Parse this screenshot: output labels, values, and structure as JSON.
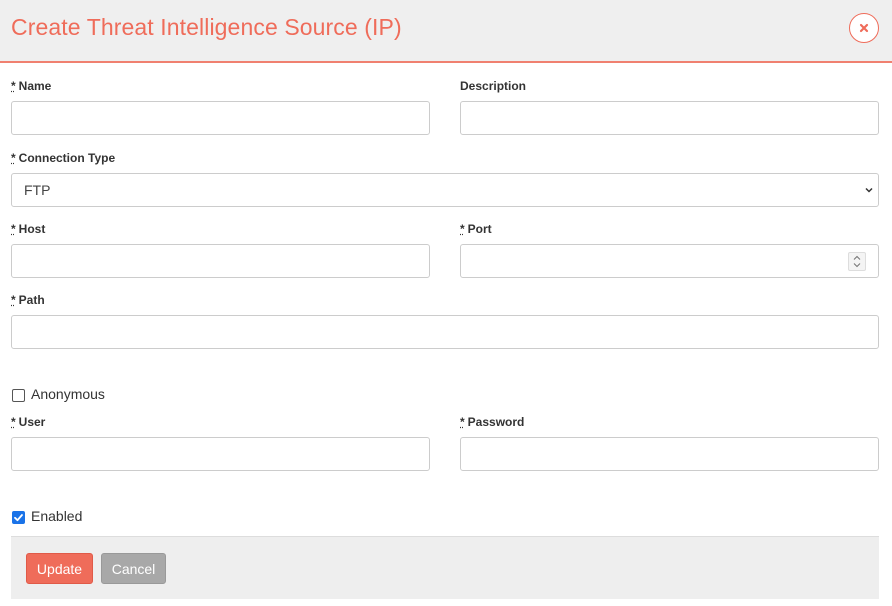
{
  "modal": {
    "title": "Create Threat Intelligence Source (IP)"
  },
  "form": {
    "required_marker": "*",
    "name": {
      "label": "Name",
      "value": ""
    },
    "description": {
      "label": "Description",
      "value": ""
    },
    "connection_type": {
      "label": "Connection Type",
      "selected": "FTP"
    },
    "host": {
      "label": "Host",
      "value": ""
    },
    "port": {
      "label": "Port",
      "value": ""
    },
    "path": {
      "label": "Path",
      "value": ""
    },
    "anonymous": {
      "label": "Anonymous",
      "checked": false
    },
    "user": {
      "label": "User",
      "value": ""
    },
    "password": {
      "label": "Password",
      "value": ""
    },
    "enabled": {
      "label": "Enabled",
      "checked": true
    }
  },
  "footer": {
    "update_label": "Update",
    "cancel_label": "Cancel"
  },
  "icons": {
    "close": "close-icon",
    "dropdown": "chevron-down-icon",
    "spinner": "number-spinner-icon",
    "check": "check-icon"
  },
  "colors": {
    "accent": "#ef6c5a",
    "checkbox_checked": "#1a73e8",
    "cancel_button": "#a8a8a8"
  }
}
